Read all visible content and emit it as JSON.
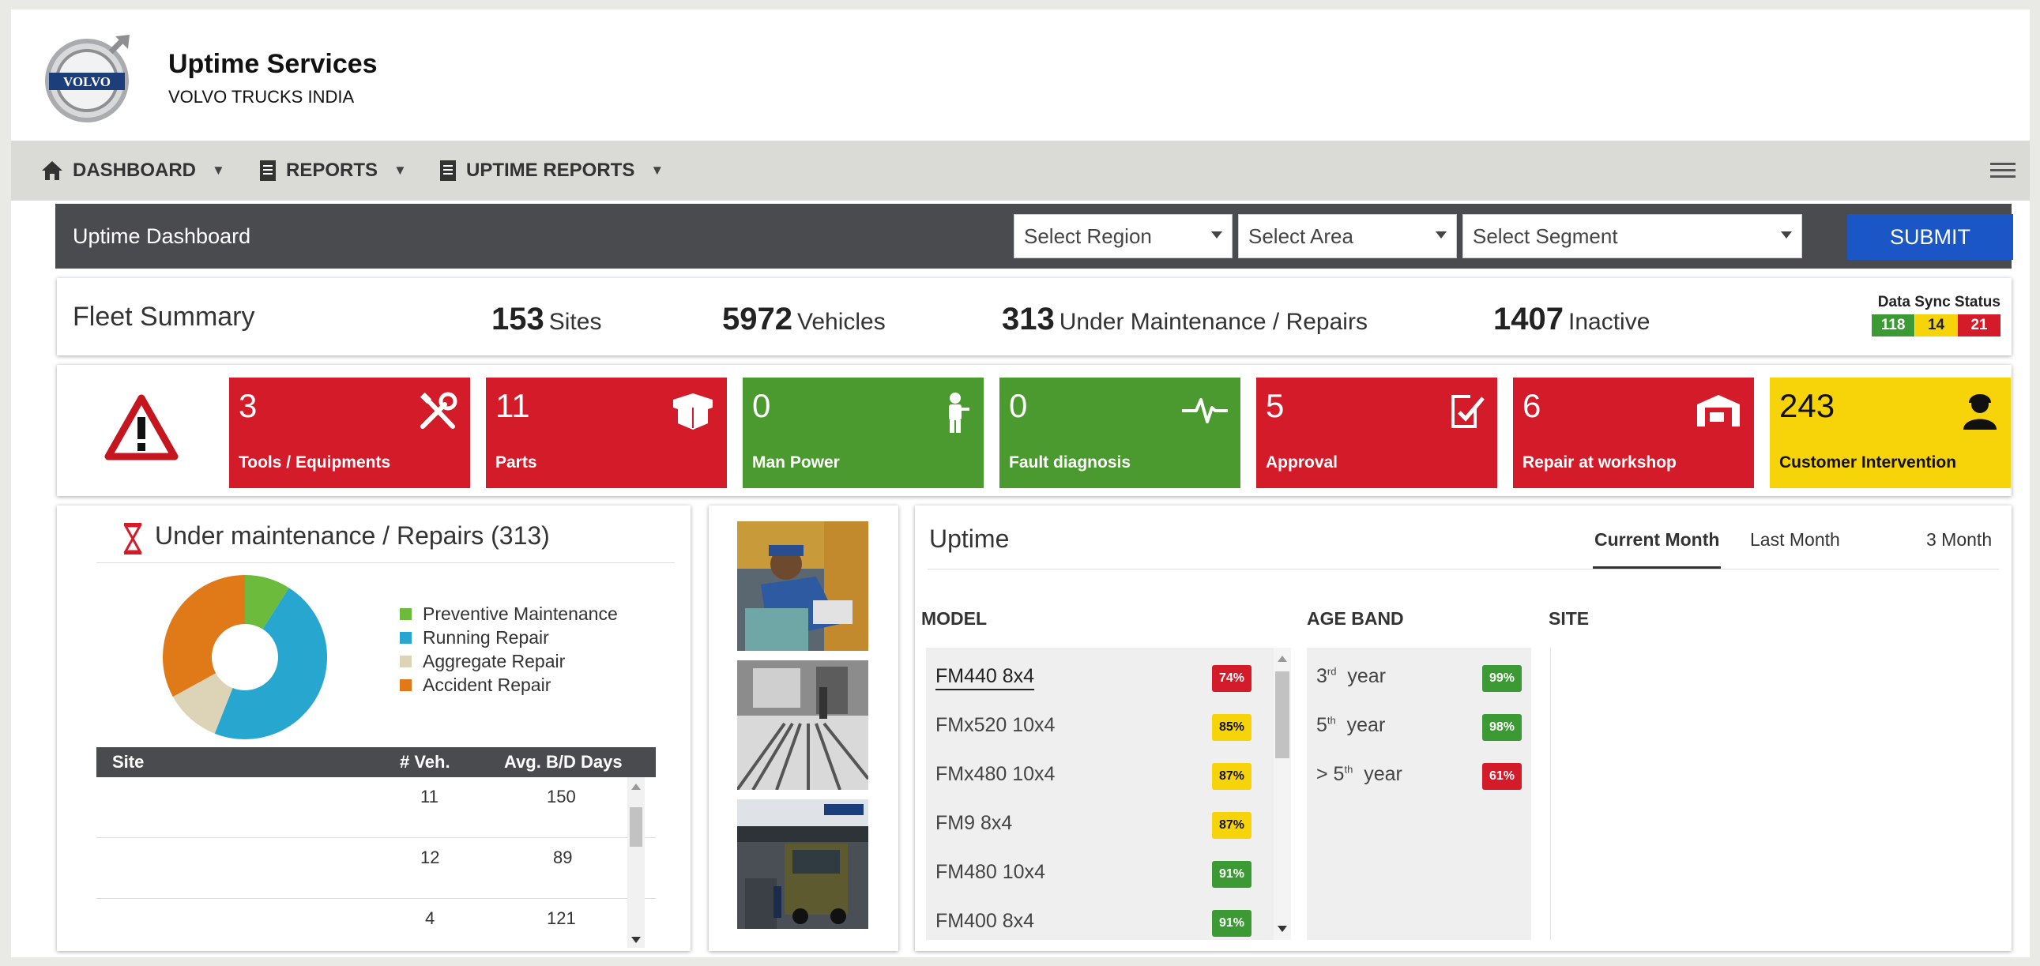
{
  "header": {
    "logo_text": "VOLVO",
    "title": "Uptime Services",
    "subtitle": "VOLVO TRUCKS INDIA"
  },
  "nav": {
    "items": [
      {
        "label": "DASHBOARD",
        "icon": "home-icon"
      },
      {
        "label": "REPORTS",
        "icon": "document-icon"
      },
      {
        "label": "UPTIME REPORTS",
        "icon": "document-icon"
      }
    ]
  },
  "titlebar": {
    "title": "Uptime  Dashboard",
    "region_placeholder": "Select Region",
    "area_placeholder": "Select Area",
    "segment_placeholder": "Select Segment",
    "submit_label": "SUBMIT"
  },
  "fleet": {
    "label": "Fleet Summary",
    "stats": [
      {
        "value": "153",
        "unit": "Sites"
      },
      {
        "value": "5972",
        "unit": "Vehicles"
      },
      {
        "value": "313",
        "unit": "Under Maintenance / Repairs"
      },
      {
        "value": "1407",
        "unit": "Inactive"
      }
    ],
    "sync": {
      "label": "Data Sync Status",
      "values": [
        {
          "value": "118",
          "color": "#3c9a34"
        },
        {
          "value": "14",
          "color": "#f7d309"
        },
        {
          "value": "21",
          "color": "#d31b2a"
        }
      ]
    }
  },
  "tiles": [
    {
      "count": "3",
      "label": "Tools / Equipments",
      "color": "red",
      "icon": "tools-icon"
    },
    {
      "count": "11",
      "label": "Parts",
      "color": "red",
      "icon": "parts-box-icon"
    },
    {
      "count": "0",
      "label": "Man Power",
      "color": "green",
      "icon": "worker-icon"
    },
    {
      "count": "0",
      "label": "Fault diagnosis",
      "color": "green",
      "icon": "pulse-icon"
    },
    {
      "count": "5",
      "label": "Approval",
      "color": "red",
      "icon": "approval-icon"
    },
    {
      "count": "6",
      "label": "Repair at workshop",
      "color": "red",
      "icon": "workshop-icon"
    },
    {
      "count": "243",
      "label": "Customer Intervention",
      "color": "yellow",
      "icon": "customer-icon"
    }
  ],
  "maintenance": {
    "title": "Under maintenance / Repairs (313)",
    "legend": [
      {
        "label": "Preventive Maintenance",
        "color": "#6dbb3c"
      },
      {
        "label": "Running Repair",
        "color": "#27a6cf"
      },
      {
        "label": "Aggregate Repair",
        "color": "#ddd3b6"
      },
      {
        "label": "Accident Repair",
        "color": "#e07a18"
      }
    ],
    "table": {
      "headers": [
        "Site",
        "# Veh.",
        "Avg. B/D Days"
      ],
      "rows": [
        {
          "site": "",
          "veh": "11",
          "days": "150"
        },
        {
          "site": "",
          "veh": "12",
          "days": "89"
        },
        {
          "site": "",
          "veh": "4",
          "days": "121"
        }
      ]
    }
  },
  "chart_data": {
    "type": "pie",
    "categories": [
      "Preventive Maintenance",
      "Running Repair",
      "Aggregate Repair",
      "Accident Repair"
    ],
    "values": [
      9,
      47,
      11,
      33
    ],
    "legend": "right"
  },
  "uptime": {
    "title": "Uptime",
    "tabs": [
      "Current Month",
      "Last Month",
      "3 Month"
    ],
    "columns": {
      "model": "MODEL",
      "age": "AGE BAND",
      "site": "SITE"
    },
    "models": [
      {
        "name": "FM440 8x4",
        "pct": "74%",
        "color": "red"
      },
      {
        "name": "FMx520 10x4",
        "pct": "85%",
        "color": "yellow"
      },
      {
        "name": "FMx480 10x4",
        "pct": "87%",
        "color": "yellow"
      },
      {
        "name": "FM9 8x4",
        "pct": "87%",
        "color": "yellow"
      },
      {
        "name": "FM480 10x4",
        "pct": "91%",
        "color": "green"
      },
      {
        "name": "FM400 8x4",
        "pct": "91%",
        "color": "green"
      }
    ],
    "age_bands": [
      {
        "prefix": "3",
        "sup": "rd",
        "suffix": "year",
        "pct": "99%",
        "color": "green"
      },
      {
        "prefix": "5",
        "sup": "th",
        "suffix": "year",
        "pct": "98%",
        "color": "green"
      },
      {
        "prefix": "> 5",
        "sup": "th",
        "suffix": "year",
        "pct": "61%",
        "color": "red"
      }
    ]
  }
}
